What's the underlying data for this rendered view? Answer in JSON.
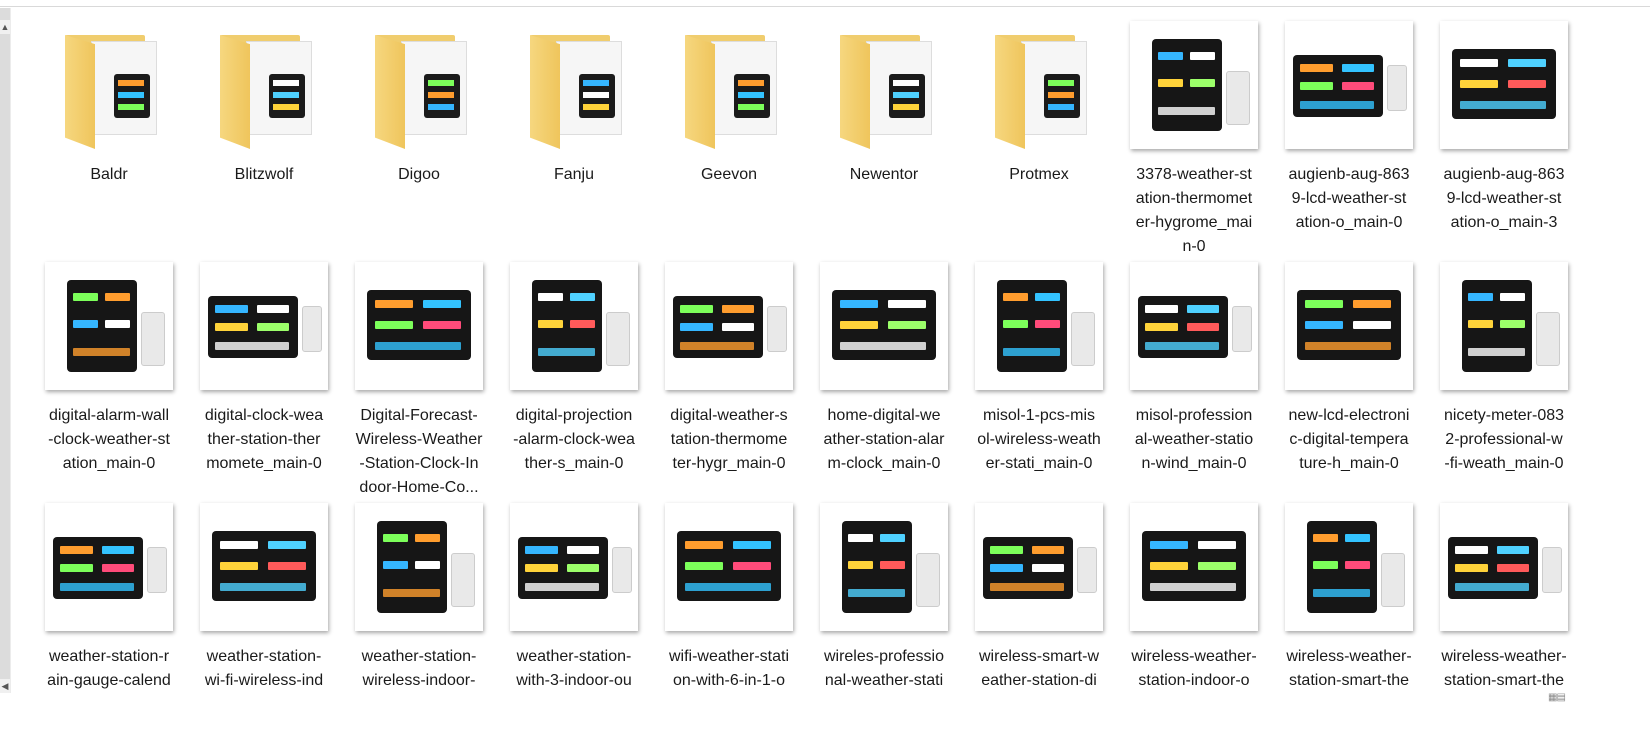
{
  "items": [
    {
      "type": "folder",
      "lines": [
        "Baldr"
      ]
    },
    {
      "type": "folder",
      "lines": [
        "Blitzwolf"
      ]
    },
    {
      "type": "folder",
      "lines": [
        "Digoo"
      ]
    },
    {
      "type": "folder",
      "lines": [
        "Fanju"
      ]
    },
    {
      "type": "folder",
      "lines": [
        "Geevon"
      ]
    },
    {
      "type": "folder",
      "lines": [
        "Newentor"
      ]
    },
    {
      "type": "folder",
      "lines": [
        "Protmex"
      ]
    },
    {
      "type": "image",
      "lines": [
        "3378-weather-st",
        "ation-thermomet",
        "er-hygrome_mai",
        "n-0"
      ]
    },
    {
      "type": "image",
      "lines": [
        "augienb-aug-863",
        "9-lcd-weather-st",
        "ation-o_main-0"
      ]
    },
    {
      "type": "image",
      "lines": [
        "augienb-aug-863",
        "9-lcd-weather-st",
        "ation-o_main-3"
      ]
    },
    {
      "type": "image",
      "lines": [
        "digital-alarm-wall",
        "-clock-weather-st",
        "ation_main-0"
      ]
    },
    {
      "type": "image",
      "lines": [
        "digital-clock-wea",
        "ther-station-ther",
        "momete_main-0"
      ]
    },
    {
      "type": "image",
      "lines": [
        "Digital-Forecast-",
        "Wireless-Weather",
        "-Station-Clock-In",
        "door-Home-Co..."
      ]
    },
    {
      "type": "image",
      "lines": [
        "digital-projection",
        "-alarm-clock-wea",
        "ther-s_main-0"
      ]
    },
    {
      "type": "image",
      "lines": [
        "digital-weather-s",
        "tation-thermome",
        "ter-hygr_main-0"
      ]
    },
    {
      "type": "image",
      "lines": [
        "home-digital-we",
        "ather-station-alar",
        "m-clock_main-0"
      ]
    },
    {
      "type": "image",
      "lines": [
        "misol-1-pcs-mis",
        "ol-wireless-weath",
        "er-stati_main-0"
      ]
    },
    {
      "type": "image",
      "lines": [
        "misol-profession",
        "al-weather-statio",
        "n-wind_main-0"
      ]
    },
    {
      "type": "image",
      "lines": [
        "new-lcd-electroni",
        "c-digital-tempera",
        "ture-h_main-0"
      ]
    },
    {
      "type": "image",
      "lines": [
        "nicety-meter-083",
        "2-professional-w",
        "-fi-weath_main-0"
      ]
    },
    {
      "type": "image",
      "lines": [
        "weather-station-r",
        "ain-gauge-calend"
      ]
    },
    {
      "type": "image",
      "lines": [
        "weather-station-",
        "wi-fi-wireless-ind"
      ]
    },
    {
      "type": "image",
      "lines": [
        "weather-station-",
        "wireless-indoor-"
      ]
    },
    {
      "type": "image",
      "lines": [
        "weather-station-",
        "with-3-indoor-ou"
      ]
    },
    {
      "type": "image",
      "lines": [
        "wifi-weather-stati",
        "on-with-6-in-1-o"
      ]
    },
    {
      "type": "image",
      "lines": [
        "wireles-professio",
        "nal-weather-stati"
      ]
    },
    {
      "type": "image",
      "lines": [
        "wireless-smart-w",
        "eather-station-di"
      ]
    },
    {
      "type": "image",
      "lines": [
        "wireless-weather-",
        "station-indoor-o"
      ]
    },
    {
      "type": "image",
      "lines": [
        "wireless-weather-",
        "station-smart-the"
      ]
    },
    {
      "type": "image",
      "lines": [
        "wireless-weather-",
        "station-smart-the"
      ]
    }
  ],
  "colors": {
    "folder": "#f0cd6e",
    "selection": "#cce8ff",
    "text": "#1a1a1a"
  }
}
